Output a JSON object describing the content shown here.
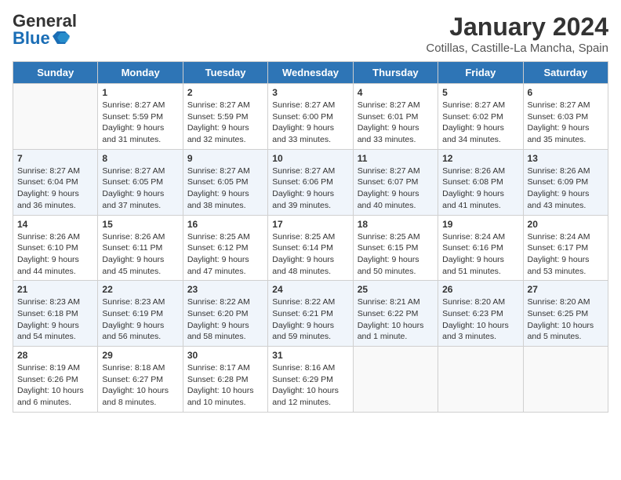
{
  "logo": {
    "general": "General",
    "blue": "Blue"
  },
  "header": {
    "month_year": "January 2024",
    "location": "Cotillas, Castille-La Mancha, Spain"
  },
  "weekdays": [
    "Sunday",
    "Monday",
    "Tuesday",
    "Wednesday",
    "Thursday",
    "Friday",
    "Saturday"
  ],
  "weeks": [
    [
      {
        "day": "",
        "sunrise": "",
        "sunset": "",
        "daylight": ""
      },
      {
        "day": "1",
        "sunrise": "Sunrise: 8:27 AM",
        "sunset": "Sunset: 5:59 PM",
        "daylight": "Daylight: 9 hours and 31 minutes."
      },
      {
        "day": "2",
        "sunrise": "Sunrise: 8:27 AM",
        "sunset": "Sunset: 5:59 PM",
        "daylight": "Daylight: 9 hours and 32 minutes."
      },
      {
        "day": "3",
        "sunrise": "Sunrise: 8:27 AM",
        "sunset": "Sunset: 6:00 PM",
        "daylight": "Daylight: 9 hours and 33 minutes."
      },
      {
        "day": "4",
        "sunrise": "Sunrise: 8:27 AM",
        "sunset": "Sunset: 6:01 PM",
        "daylight": "Daylight: 9 hours and 33 minutes."
      },
      {
        "day": "5",
        "sunrise": "Sunrise: 8:27 AM",
        "sunset": "Sunset: 6:02 PM",
        "daylight": "Daylight: 9 hours and 34 minutes."
      },
      {
        "day": "6",
        "sunrise": "Sunrise: 8:27 AM",
        "sunset": "Sunset: 6:03 PM",
        "daylight": "Daylight: 9 hours and 35 minutes."
      }
    ],
    [
      {
        "day": "7",
        "sunrise": "Sunrise: 8:27 AM",
        "sunset": "Sunset: 6:04 PM",
        "daylight": "Daylight: 9 hours and 36 minutes."
      },
      {
        "day": "8",
        "sunrise": "Sunrise: 8:27 AM",
        "sunset": "Sunset: 6:05 PM",
        "daylight": "Daylight: 9 hours and 37 minutes."
      },
      {
        "day": "9",
        "sunrise": "Sunrise: 8:27 AM",
        "sunset": "Sunset: 6:05 PM",
        "daylight": "Daylight: 9 hours and 38 minutes."
      },
      {
        "day": "10",
        "sunrise": "Sunrise: 8:27 AM",
        "sunset": "Sunset: 6:06 PM",
        "daylight": "Daylight: 9 hours and 39 minutes."
      },
      {
        "day": "11",
        "sunrise": "Sunrise: 8:27 AM",
        "sunset": "Sunset: 6:07 PM",
        "daylight": "Daylight: 9 hours and 40 minutes."
      },
      {
        "day": "12",
        "sunrise": "Sunrise: 8:26 AM",
        "sunset": "Sunset: 6:08 PM",
        "daylight": "Daylight: 9 hours and 41 minutes."
      },
      {
        "day": "13",
        "sunrise": "Sunrise: 8:26 AM",
        "sunset": "Sunset: 6:09 PM",
        "daylight": "Daylight: 9 hours and 43 minutes."
      }
    ],
    [
      {
        "day": "14",
        "sunrise": "Sunrise: 8:26 AM",
        "sunset": "Sunset: 6:10 PM",
        "daylight": "Daylight: 9 hours and 44 minutes."
      },
      {
        "day": "15",
        "sunrise": "Sunrise: 8:26 AM",
        "sunset": "Sunset: 6:11 PM",
        "daylight": "Daylight: 9 hours and 45 minutes."
      },
      {
        "day": "16",
        "sunrise": "Sunrise: 8:25 AM",
        "sunset": "Sunset: 6:12 PM",
        "daylight": "Daylight: 9 hours and 47 minutes."
      },
      {
        "day": "17",
        "sunrise": "Sunrise: 8:25 AM",
        "sunset": "Sunset: 6:14 PM",
        "daylight": "Daylight: 9 hours and 48 minutes."
      },
      {
        "day": "18",
        "sunrise": "Sunrise: 8:25 AM",
        "sunset": "Sunset: 6:15 PM",
        "daylight": "Daylight: 9 hours and 50 minutes."
      },
      {
        "day": "19",
        "sunrise": "Sunrise: 8:24 AM",
        "sunset": "Sunset: 6:16 PM",
        "daylight": "Daylight: 9 hours and 51 minutes."
      },
      {
        "day": "20",
        "sunrise": "Sunrise: 8:24 AM",
        "sunset": "Sunset: 6:17 PM",
        "daylight": "Daylight: 9 hours and 53 minutes."
      }
    ],
    [
      {
        "day": "21",
        "sunrise": "Sunrise: 8:23 AM",
        "sunset": "Sunset: 6:18 PM",
        "daylight": "Daylight: 9 hours and 54 minutes."
      },
      {
        "day": "22",
        "sunrise": "Sunrise: 8:23 AM",
        "sunset": "Sunset: 6:19 PM",
        "daylight": "Daylight: 9 hours and 56 minutes."
      },
      {
        "day": "23",
        "sunrise": "Sunrise: 8:22 AM",
        "sunset": "Sunset: 6:20 PM",
        "daylight": "Daylight: 9 hours and 58 minutes."
      },
      {
        "day": "24",
        "sunrise": "Sunrise: 8:22 AM",
        "sunset": "Sunset: 6:21 PM",
        "daylight": "Daylight: 9 hours and 59 minutes."
      },
      {
        "day": "25",
        "sunrise": "Sunrise: 8:21 AM",
        "sunset": "Sunset: 6:22 PM",
        "daylight": "Daylight: 10 hours and 1 minute."
      },
      {
        "day": "26",
        "sunrise": "Sunrise: 8:20 AM",
        "sunset": "Sunset: 6:23 PM",
        "daylight": "Daylight: 10 hours and 3 minutes."
      },
      {
        "day": "27",
        "sunrise": "Sunrise: 8:20 AM",
        "sunset": "Sunset: 6:25 PM",
        "daylight": "Daylight: 10 hours and 5 minutes."
      }
    ],
    [
      {
        "day": "28",
        "sunrise": "Sunrise: 8:19 AM",
        "sunset": "Sunset: 6:26 PM",
        "daylight": "Daylight: 10 hours and 6 minutes."
      },
      {
        "day": "29",
        "sunrise": "Sunrise: 8:18 AM",
        "sunset": "Sunset: 6:27 PM",
        "daylight": "Daylight: 10 hours and 8 minutes."
      },
      {
        "day": "30",
        "sunrise": "Sunrise: 8:17 AM",
        "sunset": "Sunset: 6:28 PM",
        "daylight": "Daylight: 10 hours and 10 minutes."
      },
      {
        "day": "31",
        "sunrise": "Sunrise: 8:16 AM",
        "sunset": "Sunset: 6:29 PM",
        "daylight": "Daylight: 10 hours and 12 minutes."
      },
      {
        "day": "",
        "sunrise": "",
        "sunset": "",
        "daylight": ""
      },
      {
        "day": "",
        "sunrise": "",
        "sunset": "",
        "daylight": ""
      },
      {
        "day": "",
        "sunrise": "",
        "sunset": "",
        "daylight": ""
      }
    ]
  ]
}
